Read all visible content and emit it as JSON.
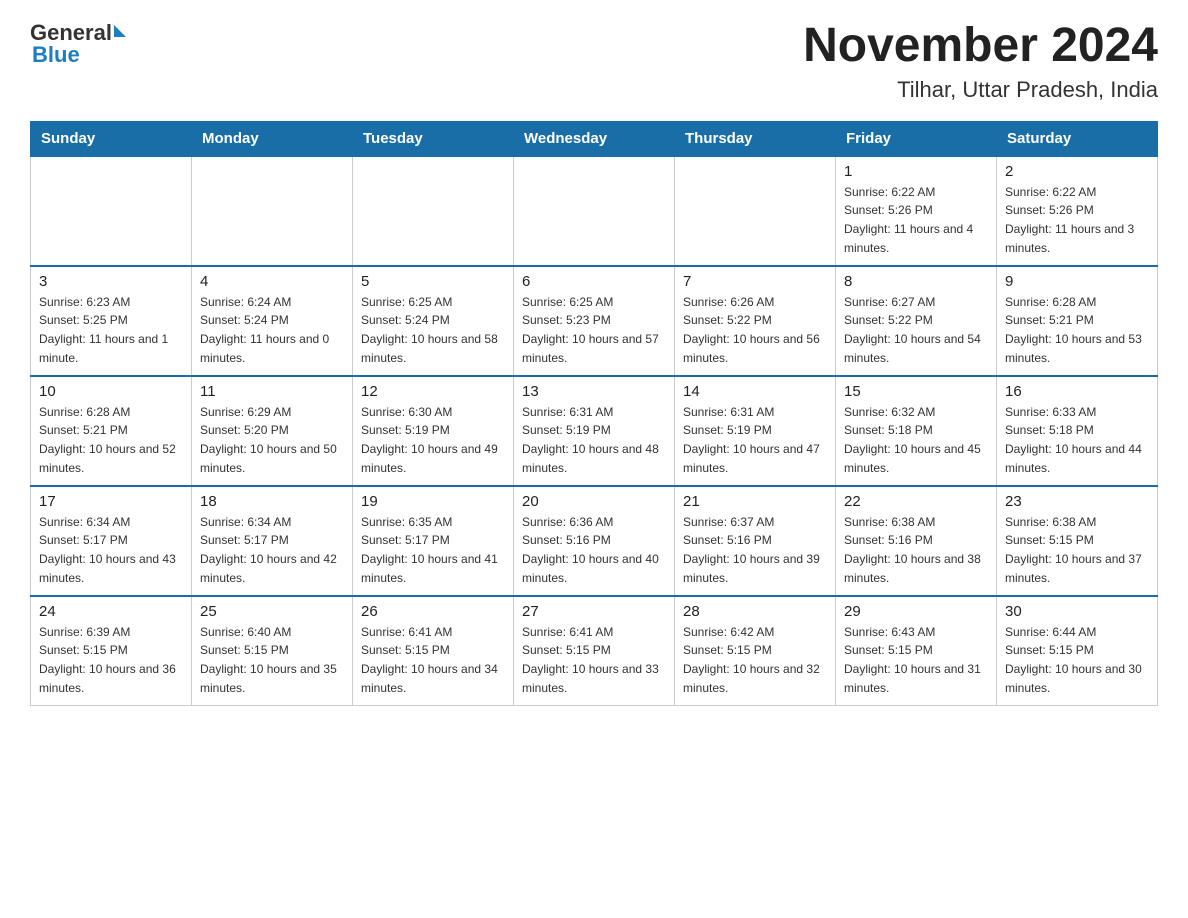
{
  "logo": {
    "general": "General",
    "blue": "Blue"
  },
  "header": {
    "title": "November 2024",
    "subtitle": "Tilhar, Uttar Pradesh, India"
  },
  "days_of_week": [
    "Sunday",
    "Monday",
    "Tuesday",
    "Wednesday",
    "Thursday",
    "Friday",
    "Saturday"
  ],
  "weeks": [
    [
      {
        "day": "",
        "info": ""
      },
      {
        "day": "",
        "info": ""
      },
      {
        "day": "",
        "info": ""
      },
      {
        "day": "",
        "info": ""
      },
      {
        "day": "",
        "info": ""
      },
      {
        "day": "1",
        "info": "Sunrise: 6:22 AM\nSunset: 5:26 PM\nDaylight: 11 hours and 4 minutes."
      },
      {
        "day": "2",
        "info": "Sunrise: 6:22 AM\nSunset: 5:26 PM\nDaylight: 11 hours and 3 minutes."
      }
    ],
    [
      {
        "day": "3",
        "info": "Sunrise: 6:23 AM\nSunset: 5:25 PM\nDaylight: 11 hours and 1 minute."
      },
      {
        "day": "4",
        "info": "Sunrise: 6:24 AM\nSunset: 5:24 PM\nDaylight: 11 hours and 0 minutes."
      },
      {
        "day": "5",
        "info": "Sunrise: 6:25 AM\nSunset: 5:24 PM\nDaylight: 10 hours and 58 minutes."
      },
      {
        "day": "6",
        "info": "Sunrise: 6:25 AM\nSunset: 5:23 PM\nDaylight: 10 hours and 57 minutes."
      },
      {
        "day": "7",
        "info": "Sunrise: 6:26 AM\nSunset: 5:22 PM\nDaylight: 10 hours and 56 minutes."
      },
      {
        "day": "8",
        "info": "Sunrise: 6:27 AM\nSunset: 5:22 PM\nDaylight: 10 hours and 54 minutes."
      },
      {
        "day": "9",
        "info": "Sunrise: 6:28 AM\nSunset: 5:21 PM\nDaylight: 10 hours and 53 minutes."
      }
    ],
    [
      {
        "day": "10",
        "info": "Sunrise: 6:28 AM\nSunset: 5:21 PM\nDaylight: 10 hours and 52 minutes."
      },
      {
        "day": "11",
        "info": "Sunrise: 6:29 AM\nSunset: 5:20 PM\nDaylight: 10 hours and 50 minutes."
      },
      {
        "day": "12",
        "info": "Sunrise: 6:30 AM\nSunset: 5:19 PM\nDaylight: 10 hours and 49 minutes."
      },
      {
        "day": "13",
        "info": "Sunrise: 6:31 AM\nSunset: 5:19 PM\nDaylight: 10 hours and 48 minutes."
      },
      {
        "day": "14",
        "info": "Sunrise: 6:31 AM\nSunset: 5:19 PM\nDaylight: 10 hours and 47 minutes."
      },
      {
        "day": "15",
        "info": "Sunrise: 6:32 AM\nSunset: 5:18 PM\nDaylight: 10 hours and 45 minutes."
      },
      {
        "day": "16",
        "info": "Sunrise: 6:33 AM\nSunset: 5:18 PM\nDaylight: 10 hours and 44 minutes."
      }
    ],
    [
      {
        "day": "17",
        "info": "Sunrise: 6:34 AM\nSunset: 5:17 PM\nDaylight: 10 hours and 43 minutes."
      },
      {
        "day": "18",
        "info": "Sunrise: 6:34 AM\nSunset: 5:17 PM\nDaylight: 10 hours and 42 minutes."
      },
      {
        "day": "19",
        "info": "Sunrise: 6:35 AM\nSunset: 5:17 PM\nDaylight: 10 hours and 41 minutes."
      },
      {
        "day": "20",
        "info": "Sunrise: 6:36 AM\nSunset: 5:16 PM\nDaylight: 10 hours and 40 minutes."
      },
      {
        "day": "21",
        "info": "Sunrise: 6:37 AM\nSunset: 5:16 PM\nDaylight: 10 hours and 39 minutes."
      },
      {
        "day": "22",
        "info": "Sunrise: 6:38 AM\nSunset: 5:16 PM\nDaylight: 10 hours and 38 minutes."
      },
      {
        "day": "23",
        "info": "Sunrise: 6:38 AM\nSunset: 5:15 PM\nDaylight: 10 hours and 37 minutes."
      }
    ],
    [
      {
        "day": "24",
        "info": "Sunrise: 6:39 AM\nSunset: 5:15 PM\nDaylight: 10 hours and 36 minutes."
      },
      {
        "day": "25",
        "info": "Sunrise: 6:40 AM\nSunset: 5:15 PM\nDaylight: 10 hours and 35 minutes."
      },
      {
        "day": "26",
        "info": "Sunrise: 6:41 AM\nSunset: 5:15 PM\nDaylight: 10 hours and 34 minutes."
      },
      {
        "day": "27",
        "info": "Sunrise: 6:41 AM\nSunset: 5:15 PM\nDaylight: 10 hours and 33 minutes."
      },
      {
        "day": "28",
        "info": "Sunrise: 6:42 AM\nSunset: 5:15 PM\nDaylight: 10 hours and 32 minutes."
      },
      {
        "day": "29",
        "info": "Sunrise: 6:43 AM\nSunset: 5:15 PM\nDaylight: 10 hours and 31 minutes."
      },
      {
        "day": "30",
        "info": "Sunrise: 6:44 AM\nSunset: 5:15 PM\nDaylight: 10 hours and 30 minutes."
      }
    ]
  ]
}
